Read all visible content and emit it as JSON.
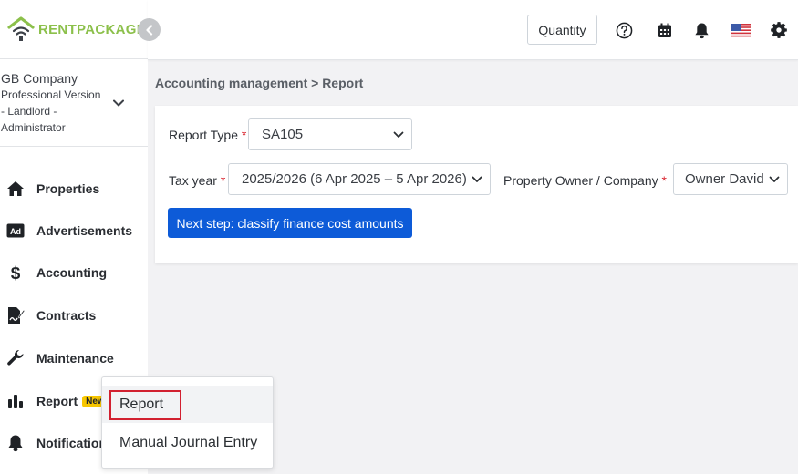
{
  "app": {
    "logo_rent": "RENT",
    "logo_package": "PACKAGE"
  },
  "company": {
    "name": "GB Company",
    "version": "Professional Version",
    "role_line1": "- Landlord -",
    "role_line2": "Administrator"
  },
  "sidebar": {
    "items": [
      {
        "label": "Properties",
        "icon": "home-icon"
      },
      {
        "label": "Advertisements",
        "icon": "ad-icon"
      },
      {
        "label": "Accounting",
        "icon": "dollar-icon"
      },
      {
        "label": "Contracts",
        "icon": "contract-icon"
      },
      {
        "label": "Maintenance",
        "icon": "wrench-icon"
      },
      {
        "label": "Report",
        "icon": "bar-chart-icon",
        "badge": "New"
      },
      {
        "label": "Notification",
        "icon": "bell-icon"
      }
    ]
  },
  "topbar": {
    "quantity_label": "Quantity"
  },
  "breadcrumb": "Accounting management > Report",
  "form": {
    "report_type_label": "Report Type",
    "report_type_value": "SA105",
    "tax_year_label": "Tax year",
    "tax_year_value": "2025/2026 (6 Apr 2025 – 5 Apr 2026)",
    "owner_label": "Property Owner / Company",
    "owner_value": "Owner David",
    "required_mark": "*",
    "next_button": "Next step: classify finance cost amounts"
  },
  "submenu": {
    "items": [
      "Report",
      "Manual Journal Entry"
    ]
  },
  "colors": {
    "brand_green": "#8cc04b",
    "primary": "#0d5bd8",
    "badge": "#f7c600",
    "highlight": "#d22030"
  }
}
